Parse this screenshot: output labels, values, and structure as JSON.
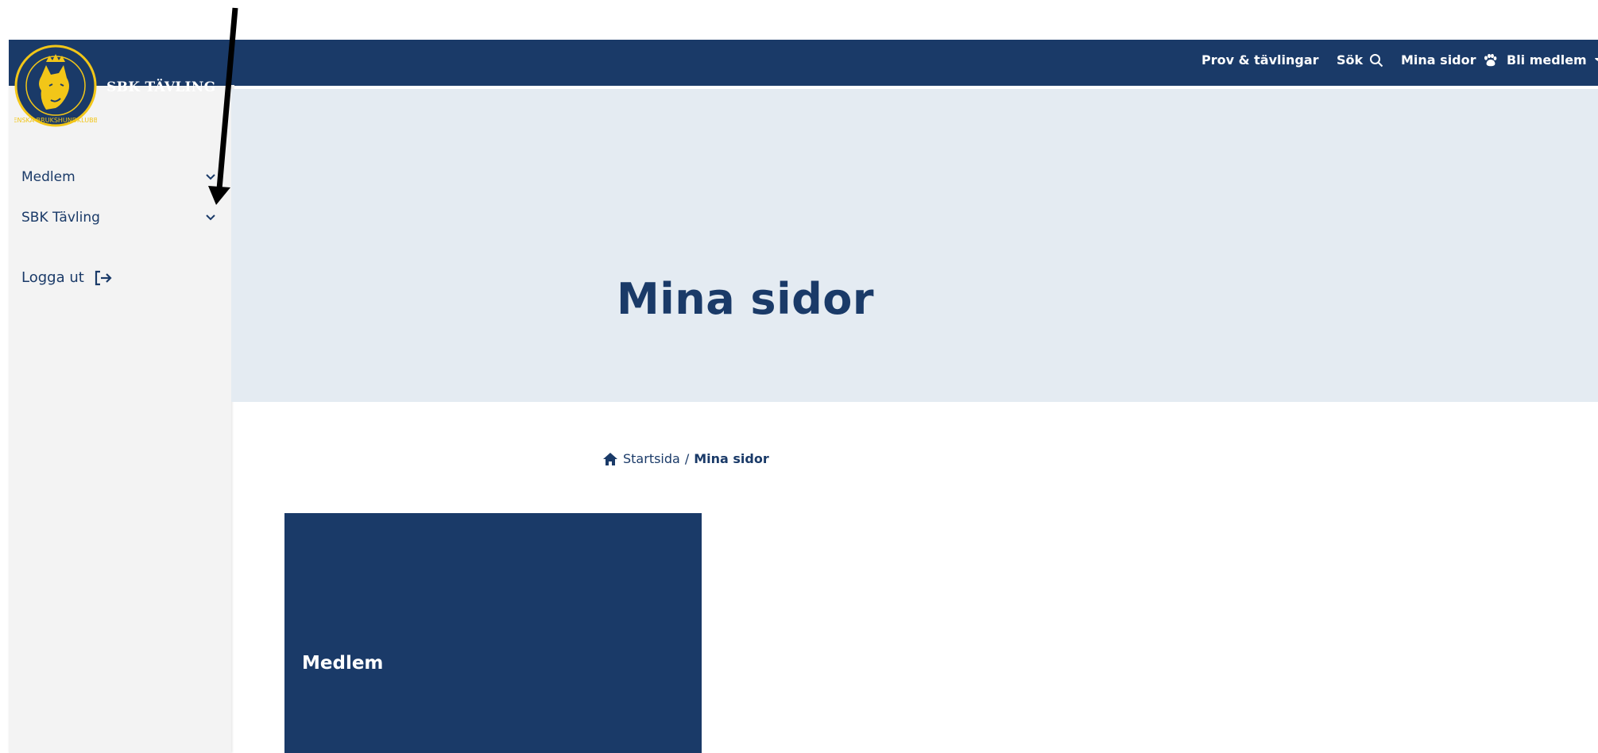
{
  "brand": {
    "site_name": "SBK TÄVLING",
    "logo_icon": "sbk-dog-emblem-icon",
    "colors": {
      "navy": "#1a3a68",
      "gold": "#f2c618",
      "hero_bg": "#e4ebf2",
      "sidebar_bg": "#f3f3f3"
    }
  },
  "topnav": {
    "items": [
      {
        "label": "Prov & tävlingar",
        "icon": ""
      },
      {
        "label": "Sök",
        "icon": "search-icon"
      },
      {
        "label": "Mina sidor",
        "icon": "paw-icon"
      },
      {
        "label": "Bli medlem",
        "icon": "dog-icon"
      }
    ]
  },
  "sidebar": {
    "items": [
      {
        "label": "Medlem",
        "icon": "chevron-down-icon"
      },
      {
        "label": "SBK Tävling",
        "icon": "chevron-down-icon"
      }
    ],
    "logout_label": "Logga ut",
    "logout_icon": "logout-icon"
  },
  "hero": {
    "title": "Mina sidor"
  },
  "breadcrumb": {
    "home_icon": "home-icon",
    "home_label": "Startsida",
    "separator": "/",
    "current": "Mina sidor"
  },
  "cards": [
    {
      "label": "Medlem"
    }
  ],
  "annotation": {
    "icon": "arrow-annotation-icon"
  }
}
